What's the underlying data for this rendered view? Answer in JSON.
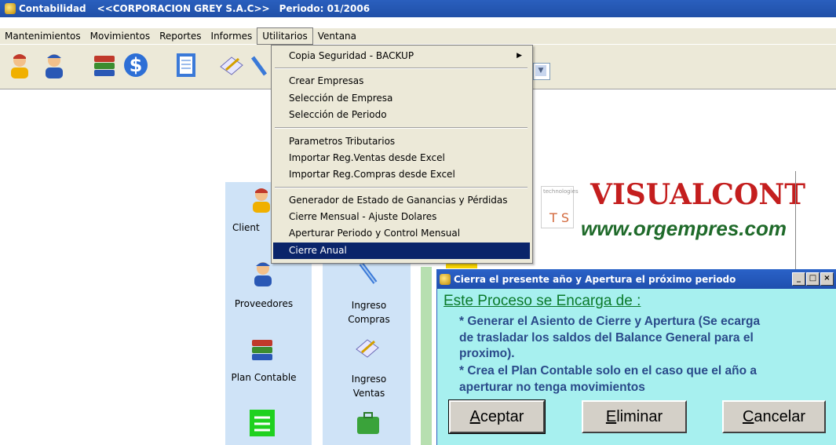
{
  "window": {
    "app": "Contabilidad",
    "company": "<<CORPORACION GREY S.A.C>>",
    "period": "Periodo: 01/2006"
  },
  "menubar": [
    "Mantenimientos",
    "Movimientos",
    "Reportes",
    "Informes",
    "Utilitarios",
    "Ventana"
  ],
  "dropdown": {
    "items": [
      {
        "label": "Copia Seguridad - BACKUP",
        "submenu": true
      },
      {
        "label": "Crear Empresas"
      },
      {
        "label": "Selección de Empresa"
      },
      {
        "label": "Selección de Periodo"
      },
      {
        "label": "Parametros Tributarios"
      },
      {
        "label": "Importar Reg.Ventas desde Excel"
      },
      {
        "label": "Importar Reg.Compras desde Excel"
      },
      {
        "label": "Generador de Estado de Ganancias y Pérdidas"
      },
      {
        "label": "Cierre Mensual - Ajuste Dolares"
      },
      {
        "label": "Aperturar Periodo y Control Mensual"
      },
      {
        "label": "Cierre Anual",
        "selected": true
      }
    ]
  },
  "panel_left": [
    "Client",
    "Proveedores",
    "Plan Contable"
  ],
  "panel_mid": [
    "Ingreso\nCompras",
    "Ingreso\nVentas"
  ],
  "logo": {
    "badge": "technologies",
    "letters": "T S",
    "title": "VISUALCONT",
    "website": "www.orgempres.com"
  },
  "dialog": {
    "title": "Cierra el presente año y Apertura el próximo periodo",
    "heading": "Este Proceso se Encarga de :",
    "line1": "* Generar el Asiento de Cierre y Apertura (Se ecarga",
    "line2": "de trasladar los saldos del Balance General para el",
    "line3": "proximo).",
    "line4": "* Crea el Plan Contable solo en el caso que el año a",
    "line5": "aperturar no tenga movimientos",
    "btn_accept_u": "A",
    "btn_accept_rest": "ceptar",
    "btn_delete_u": "E",
    "btn_delete_rest": "liminar",
    "btn_cancel_u": "C",
    "btn_cancel_rest": "ancelar"
  }
}
